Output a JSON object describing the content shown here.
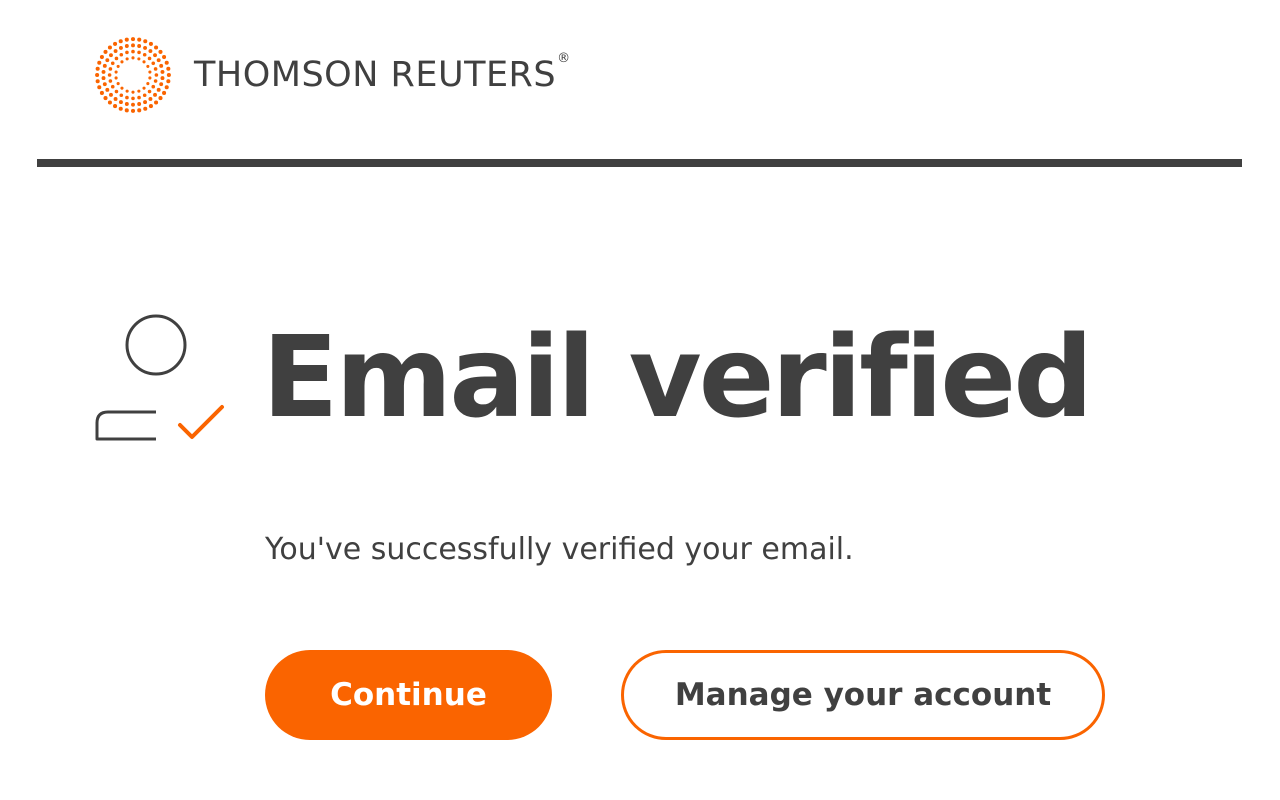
{
  "brand": {
    "name": "THOMSON REUTERS",
    "registered_mark": "®",
    "accent_color": "#fa6400",
    "text_color": "#404040"
  },
  "main": {
    "icon": "user-check-icon",
    "title": "Email verified",
    "message": "You've successfully verified your email.",
    "continue_label": "Continue",
    "manage_label": "Manage your account"
  }
}
